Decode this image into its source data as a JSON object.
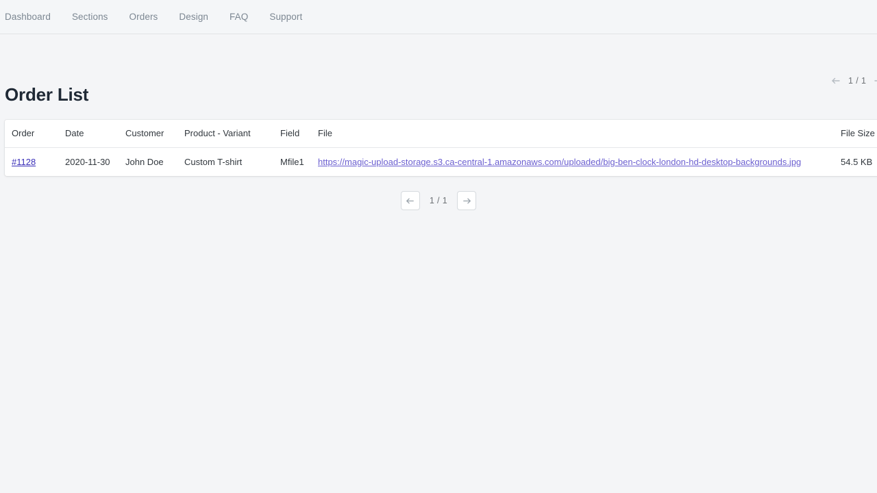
{
  "nav": {
    "items": [
      {
        "label": "Dashboard"
      },
      {
        "label": "Sections"
      },
      {
        "label": "Orders"
      },
      {
        "label": "Design"
      },
      {
        "label": "FAQ"
      },
      {
        "label": "Support"
      }
    ]
  },
  "page": {
    "title": "Order List"
  },
  "top_pagination": {
    "label": "1 / 1",
    "prev_icon": "arrow-left-icon",
    "next_icon": "arrow-right-icon"
  },
  "table": {
    "columns": [
      "Order",
      "Date",
      "Customer",
      "Product - Variant",
      "Field",
      "File",
      "File Size"
    ],
    "rows": [
      {
        "order": "#1128",
        "date": "2020-11-30",
        "customer": "John Doe",
        "product_variant": "Custom T-shirt",
        "field": "Mfile1",
        "file": "https://magic-upload-storage.s3.ca-central-1.amazonaws.com/uploaded/big-ben-clock-london-hd-desktop-backgrounds.jpg",
        "file_size": "54.5 KB"
      }
    ]
  },
  "bottom_pagination": {
    "label": "1 / 1",
    "prev_icon": "arrow-left-icon",
    "next_icon": "arrow-right-icon"
  },
  "colors": {
    "page_background": "#f4f5f7",
    "nav_background": "#f4f6f8",
    "nav_text": "#7c8792",
    "title_text": "#1f2935",
    "card_background": "#ffffff",
    "order_link": "#3a2fb8",
    "file_link": "#6b5fd0",
    "border": "#e6e8ea"
  }
}
